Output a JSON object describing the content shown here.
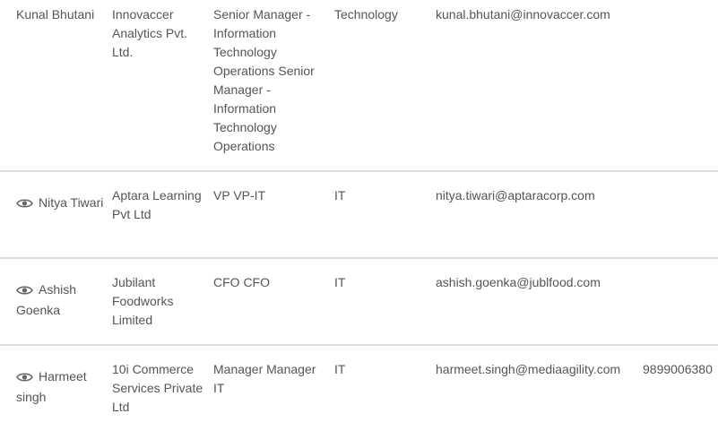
{
  "contacts": [
    {
      "name": "Kunal Bhutani",
      "has_view_icon": false,
      "company": "Innovaccer Analytics Pvt. Ltd.",
      "title": "Senior Manager - Information Technology Operations Senior Manager - Information Technology Operations",
      "industry": "Technology",
      "email": "kunal.bhutani@innovaccer.com",
      "phone": ""
    },
    {
      "name": "Nitya Tiwari",
      "has_view_icon": true,
      "company": "Aptara Learning Pvt Ltd",
      "title": "VP VP-IT",
      "industry": "IT",
      "email": "nitya.tiwari@aptaracorp.com",
      "phone": ""
    },
    {
      "name": "Ashish Goenka",
      "has_view_icon": true,
      "company": "Jubilant Foodworks Limited",
      "title": "CFO CFO",
      "industry": "IT",
      "email": "ashish.goenka@jublfood.com",
      "phone": ""
    },
    {
      "name": "Harmeet singh",
      "has_view_icon": true,
      "company": "10i Commerce Services Private Ltd",
      "title": "Manager Manager IT",
      "industry": "IT",
      "email": "harmeet.singh@mediaagility.com",
      "phone": "9899006380"
    }
  ],
  "icons": {
    "view": "eye-icon"
  },
  "colors": {
    "text": "#555555",
    "separator": "#dedede",
    "icon": "#666666"
  }
}
